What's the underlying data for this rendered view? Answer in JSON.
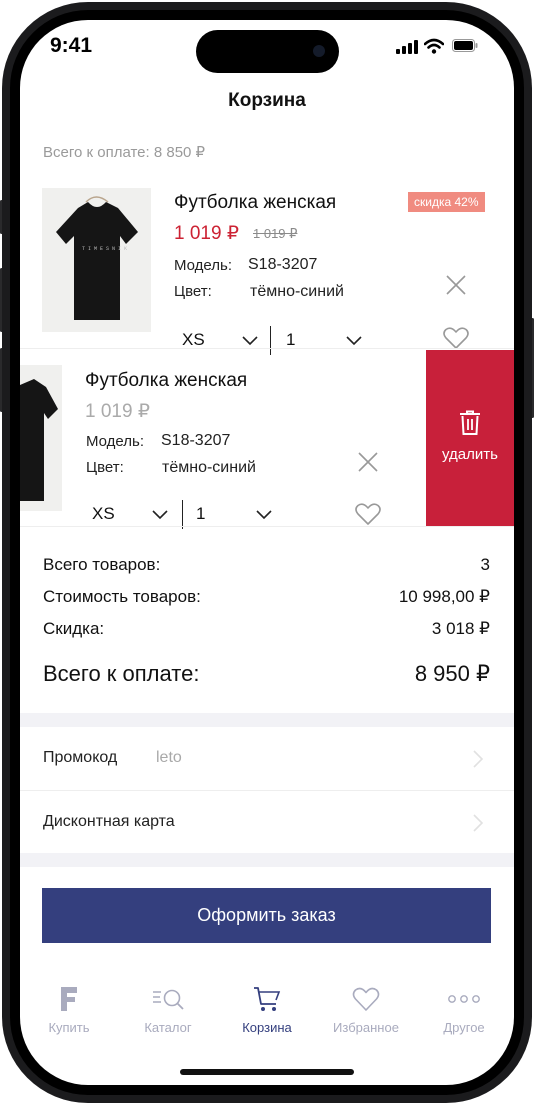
{
  "status": {
    "time": "9:41"
  },
  "header": {
    "title": "Корзина"
  },
  "cart": {
    "total_top": "Всего к оплате: 8 850 ₽",
    "items": [
      {
        "name": "Футболка женская",
        "price": "1 019 ₽",
        "old_price": "1 019 ₽",
        "discount_badge": "скидка 42%",
        "model_label": "Модель:",
        "model_value": "S18-3207",
        "color_label": "Цвет:",
        "color_value": "тёмно-синий",
        "size": "XS",
        "quantity": "1"
      },
      {
        "name": "Футболка женская",
        "price": "1 019 ₽",
        "model_label": "Модель:",
        "model_value": "S18-3207",
        "color_label": "Цвет:",
        "color_value": "тёмно-синий",
        "size": "XS",
        "quantity": "1",
        "delete_label": "удалить"
      }
    ]
  },
  "summary": {
    "items_count_label": "Всего товаров:",
    "items_count_value": "3",
    "cost_label": "Стоимость товаров:",
    "cost_value": "10 998,00 ₽",
    "discount_label": "Скидка:",
    "discount_value": "3 018 ₽",
    "total_label": "Всего к оплате:",
    "total_value": "8 950 ₽"
  },
  "promo": {
    "label": "Промокод",
    "value": "leto"
  },
  "discount_card": {
    "label": "Дисконтная карта"
  },
  "checkout": {
    "label": "Оформить заказ"
  },
  "tabbar": [
    {
      "label": "Купить",
      "icon": "brand-logo-icon",
      "active": false
    },
    {
      "label": "Каталог",
      "icon": "catalog-search-icon",
      "active": false
    },
    {
      "label": "Корзина",
      "icon": "cart-icon",
      "active": true
    },
    {
      "label": "Избранное",
      "icon": "heart-icon",
      "active": false
    },
    {
      "label": "Другое",
      "icon": "more-dots-icon",
      "active": false
    }
  ],
  "colors": {
    "accent": "#343f7e",
    "price_red": "#cc2233",
    "delete_red": "#c8203a",
    "badge": "#f08b80"
  }
}
